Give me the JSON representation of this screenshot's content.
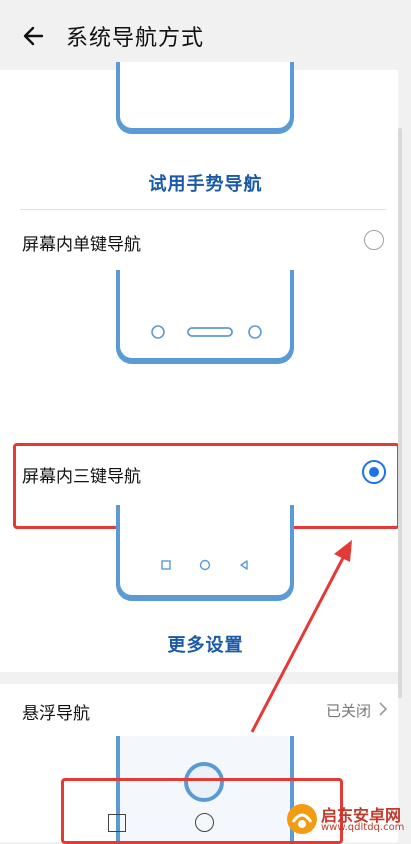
{
  "header": {
    "title": "系统导航方式"
  },
  "gesture": {
    "try_link": "试用手势导航"
  },
  "options": [
    {
      "label": "屏幕内单键导航",
      "selected": false
    },
    {
      "label": "屏幕内三键导航",
      "selected": true
    }
  ],
  "more_settings": "更多设置",
  "floating": {
    "label": "悬浮导航",
    "status": "已关闭"
  },
  "watermark": {
    "name": "启东安卓网",
    "url": "www.qdltdq.com"
  },
  "colors": {
    "accent": "#1a73e8",
    "phone_frame": "#5b9bd5",
    "annotation": "#e53935",
    "link": "#1a5aa6"
  }
}
